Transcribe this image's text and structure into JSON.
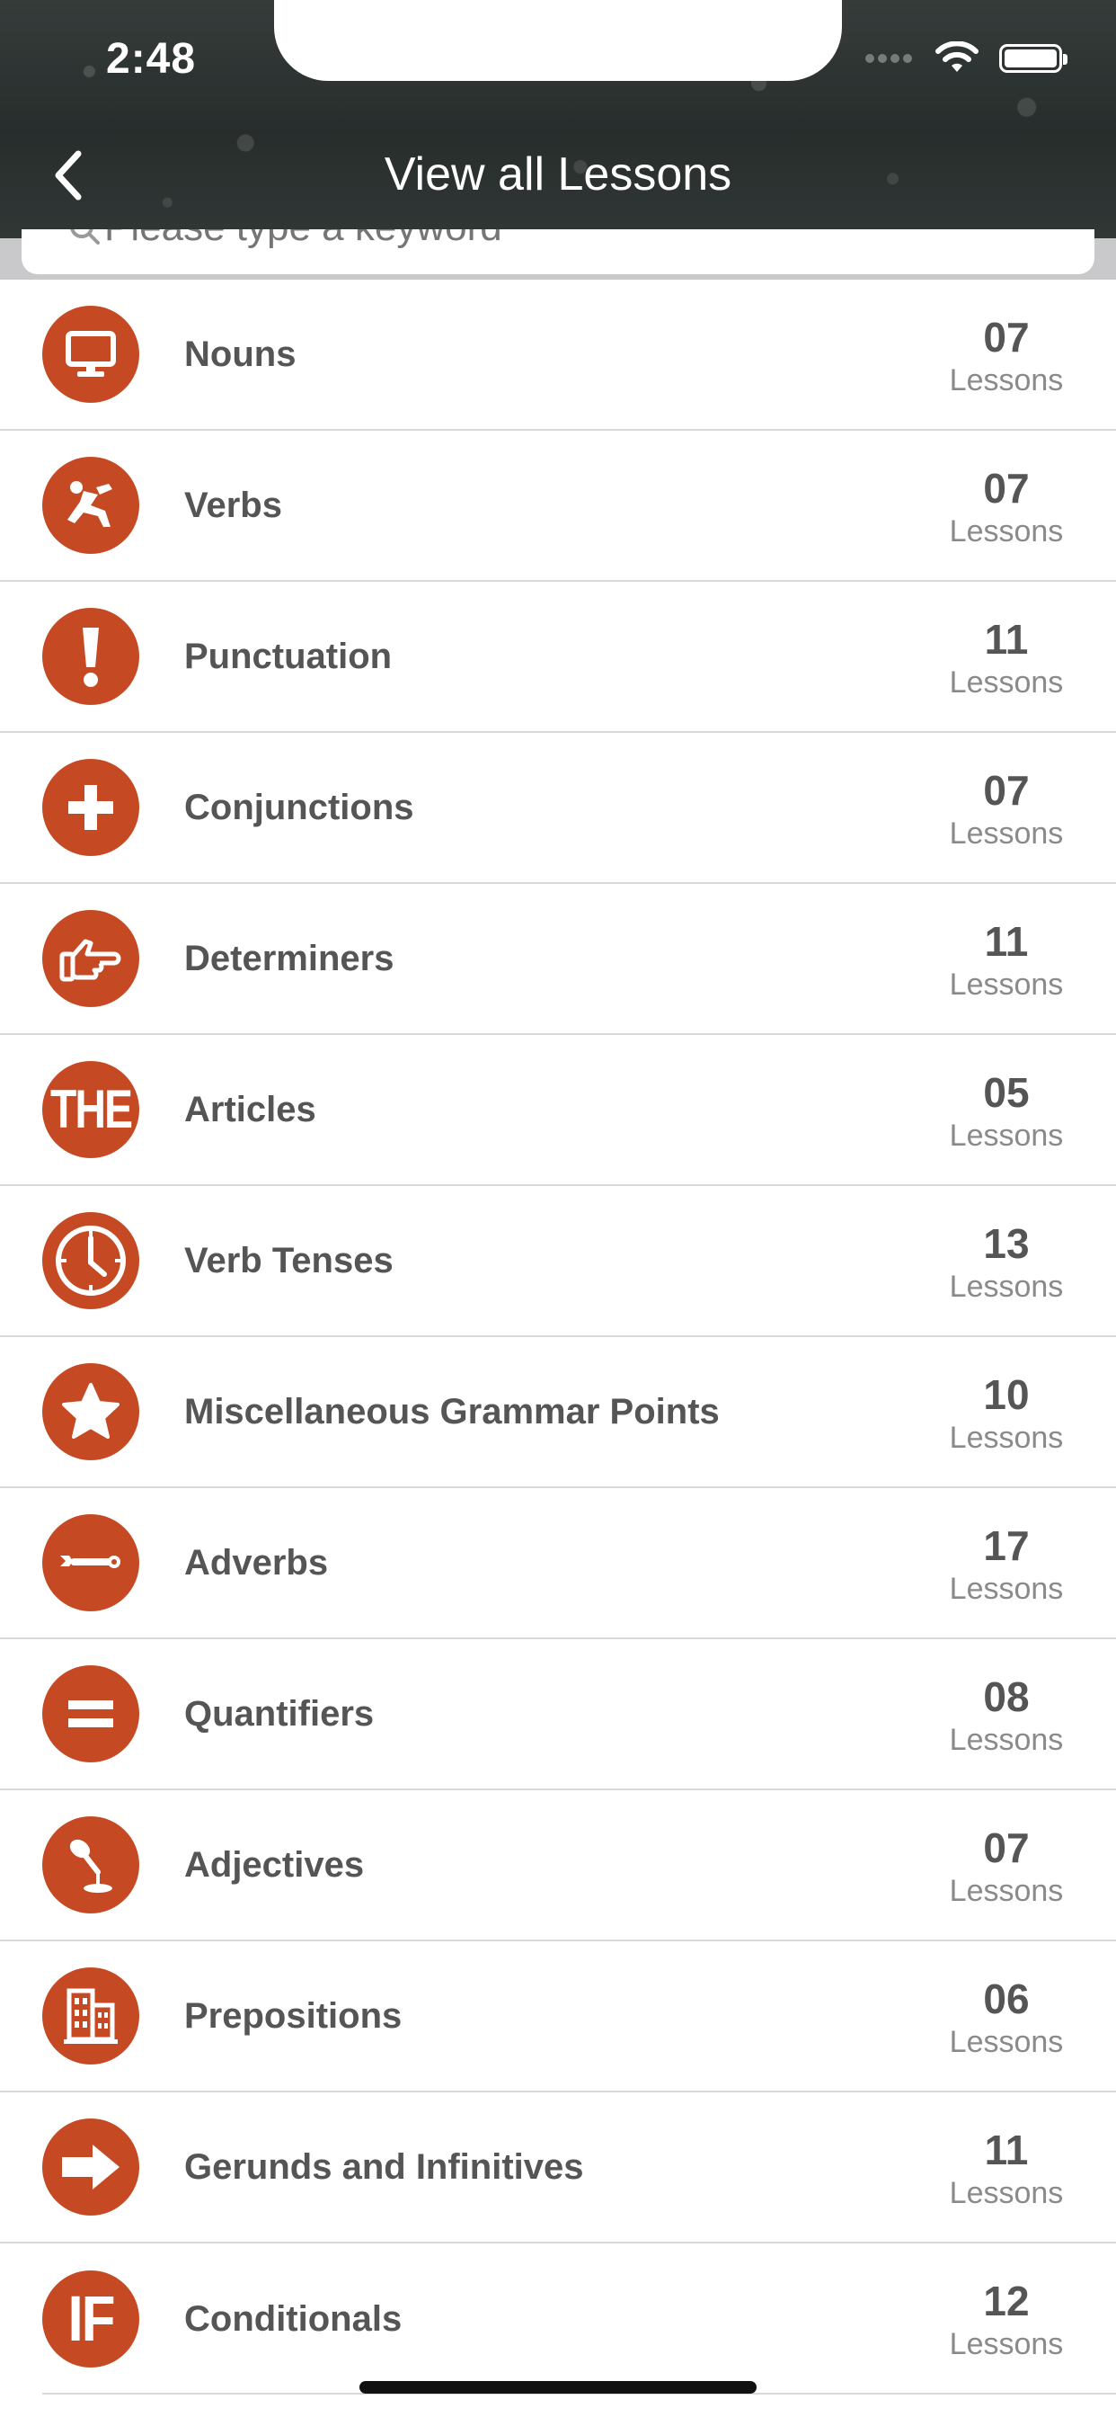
{
  "status_bar": {
    "time": "2:48"
  },
  "nav": {
    "title": "View all Lessons"
  },
  "search": {
    "placeholder": "Please type a keyword"
  },
  "lessons": [
    {
      "title": "Nouns",
      "count": "07",
      "unit": "Lessons",
      "icon": "monitor-icon"
    },
    {
      "title": "Verbs",
      "count": "07",
      "unit": "Lessons",
      "icon": "runner-icon"
    },
    {
      "title": "Punctuation",
      "count": "11",
      "unit": "Lessons",
      "icon": "exclamation-icon"
    },
    {
      "title": "Conjunctions",
      "count": "07",
      "unit": "Lessons",
      "icon": "plus-icon"
    },
    {
      "title": "Determiners",
      "count": "11",
      "unit": "Lessons",
      "icon": "pointing-hand-icon"
    },
    {
      "title": "Articles",
      "count": "05",
      "unit": "Lessons",
      "icon": "the-text-icon",
      "icon_text": "THE"
    },
    {
      "title": "Verb Tenses",
      "count": "13",
      "unit": "Lessons",
      "icon": "clock-icon"
    },
    {
      "title": "Miscellaneous Grammar Points",
      "count": "10",
      "unit": "Lessons",
      "icon": "star-icon"
    },
    {
      "title": "Adverbs",
      "count": "17",
      "unit": "Lessons",
      "icon": "wrench-icon"
    },
    {
      "title": "Quantifiers",
      "count": "08",
      "unit": "Lessons",
      "icon": "equals-icon"
    },
    {
      "title": "Adjectives",
      "count": "07",
      "unit": "Lessons",
      "icon": "microphone-icon"
    },
    {
      "title": "Prepositions",
      "count": "06",
      "unit": "Lessons",
      "icon": "building-icon"
    },
    {
      "title": "Gerunds and Infinitives",
      "count": "11",
      "unit": "Lessons",
      "icon": "arrow-right-icon"
    },
    {
      "title": "Conditionals",
      "count": "12",
      "unit": "Lessons",
      "icon": "if-text-icon",
      "icon_text": "IF"
    }
  ],
  "colors": {
    "accent": "#c54a23",
    "text": "#555555",
    "subtext": "#8a8a8a"
  }
}
